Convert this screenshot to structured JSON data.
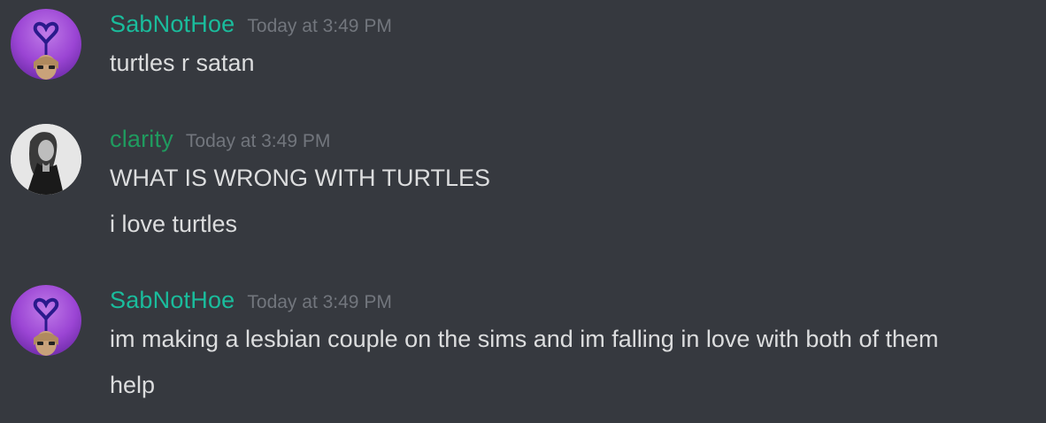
{
  "messages": [
    {
      "author": "SabNotHoe",
      "author_color": "#1abc9c",
      "timestamp": "Today at 3:49 PM",
      "avatar_icon": "purple-heart-balloon-avatar",
      "lines": [
        "turtles r satan"
      ]
    },
    {
      "author": "clarity",
      "author_color": "#1f9b5f",
      "timestamp": "Today at 3:49 PM",
      "avatar_icon": "grayscale-portrait-avatar",
      "lines": [
        "WHAT IS WRONG WITH TURTLES",
        "i love turtles"
      ]
    },
    {
      "author": "SabNotHoe",
      "author_color": "#1abc9c",
      "timestamp": "Today at 3:49 PM",
      "avatar_icon": "purple-heart-balloon-avatar",
      "lines": [
        "im making a lesbian couple on the sims and im falling in love with both of them",
        "help"
      ]
    }
  ]
}
